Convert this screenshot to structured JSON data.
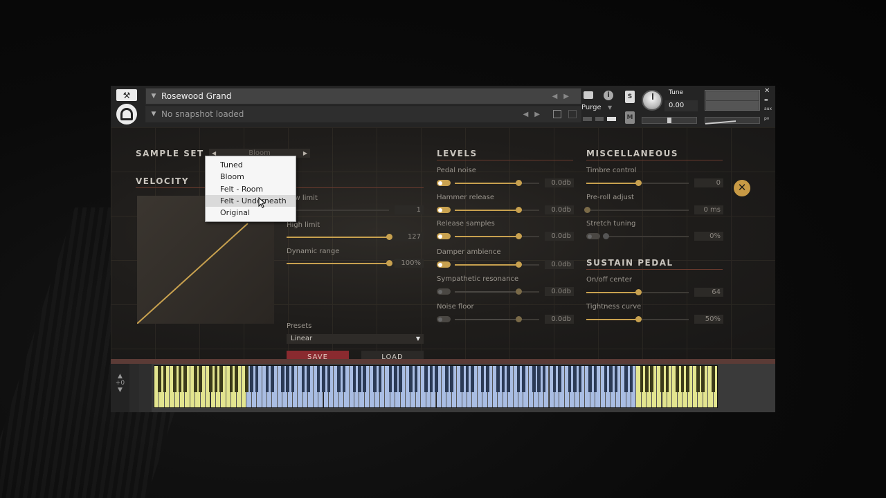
{
  "header": {
    "instrument_name": "Rosewood Grand",
    "snapshot_text": "No snapshot loaded",
    "purge_label": "Purge",
    "tune_label": "Tune",
    "tune_value": "0.00",
    "solo_label": "S",
    "mute_label": "M",
    "close_label": "✕",
    "aux_label": "aux",
    "pv_label": "pv"
  },
  "sample_set": {
    "title": "SAMPLE SET",
    "value": "Bloom",
    "options": [
      "Tuned",
      "Bloom",
      "Felt - Room",
      "Felt - Underneath",
      "Original"
    ],
    "highlighted": "Felt - Underneath"
  },
  "velocity": {
    "title": "VELOCITY",
    "low_limit_label": "Low limit",
    "low_limit_value": "1",
    "high_limit_label": "High limit",
    "high_limit_value": "127",
    "dynamic_range_label": "Dynamic range",
    "dynamic_range_value": "100%",
    "presets_label": "Presets",
    "preset_value": "Linear",
    "save_label": "SAVE",
    "load_label": "LOAD",
    "sliders": {
      "low_limit": 0.0,
      "high_limit": 1.0,
      "dynamic_range": 1.0
    }
  },
  "levels": {
    "title": "LEVELS",
    "items": [
      {
        "label": "Pedal noise",
        "value": "0.0db",
        "on": true,
        "level": 0.75
      },
      {
        "label": "Hammer release",
        "value": "0.0db",
        "on": true,
        "level": 0.75
      },
      {
        "label": "Release samples",
        "value": "0.0db",
        "on": true,
        "level": 0.75
      },
      {
        "label": "Damper ambience",
        "value": "0.0db",
        "on": true,
        "level": 0.75
      },
      {
        "label": "Sympathetic resonance",
        "value": "0.0db",
        "on": false,
        "level": 0.75
      },
      {
        "label": "Noise floor",
        "value": "0.0db",
        "on": false,
        "level": 0.75
      }
    ]
  },
  "misc": {
    "title": "MISCELLANEOUS",
    "timbre_label": "Timbre control",
    "timbre_value": "0",
    "preroll_label": "Pre-roll adjust",
    "preroll_value": "0 ms",
    "stretch_label": "Stretch tuning",
    "stretch_value": "0%"
  },
  "sustain": {
    "title": "SUSTAIN PEDAL",
    "onoff_label": "On/off center",
    "onoff_value": "64",
    "tightness_label": "Tightness curve",
    "tightness_value": "50%"
  },
  "keyboard": {
    "octave_label": "+0"
  },
  "colors": {
    "accent": "#c8a14f",
    "save": "#8a2a2f",
    "key_blue": "#a9bde3",
    "key_yellow": "#e3e58f"
  }
}
